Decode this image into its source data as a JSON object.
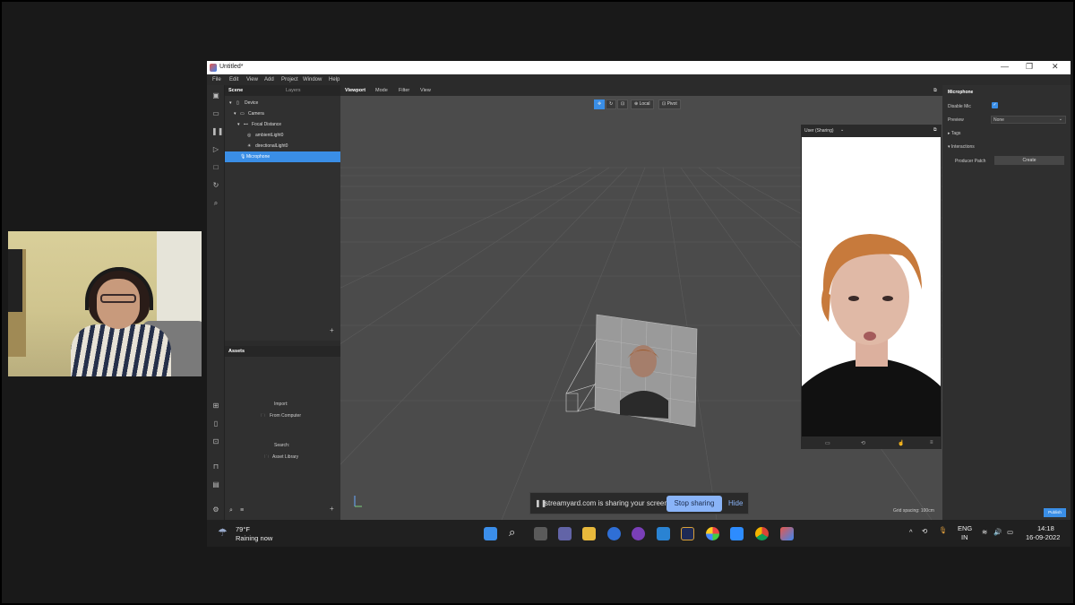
{
  "window": {
    "title": "Untitled*",
    "min": "—",
    "max": "❐",
    "close": "✕"
  },
  "menu": [
    "File",
    "Edit",
    "View",
    "Add",
    "Project",
    "Window",
    "Help"
  ],
  "scene": {
    "tab_scene": "Scene",
    "tab_layers": "Layers",
    "items": [
      {
        "label": "Device"
      },
      {
        "label": "Camera"
      },
      {
        "label": "Focal Distance"
      },
      {
        "label": "ambientLight0"
      },
      {
        "label": "directionalLight0"
      },
      {
        "label": "Microphone"
      }
    ],
    "add": "+"
  },
  "assets": {
    "title": "Assets",
    "import_label": "Import:",
    "from_computer": "From Computer",
    "search_label": "Search:",
    "asset_library": "Asset Library",
    "add": "+"
  },
  "viewport": {
    "tabs": [
      "Viewport",
      "Mode",
      "Filter",
      "View"
    ],
    "local": "Local",
    "pivot": "Pivot",
    "grid_spacing": "Grid spacing: 100cm"
  },
  "simulator": {
    "device": "User (Sharing)"
  },
  "inspector": {
    "title": "Microphone",
    "disable_mic": "Disable Mic",
    "disable_mic_checked": true,
    "preview_label": "Preview",
    "preview_value": "None",
    "tags": "Tags",
    "interactions": "Interactions",
    "producer_patch": "Producer Patch",
    "create": "Create",
    "publish": "Publish"
  },
  "share": {
    "message": "streamyard.com is sharing your screen.",
    "stop": "Stop sharing",
    "hide": "Hide"
  },
  "taskbar": {
    "weather_temp": "79°F",
    "weather_desc": "Raining now",
    "lang1": "ENG",
    "lang2": "IN",
    "time": "14:18",
    "date": "16-09-2022"
  },
  "colors": {
    "selection": "#3a8ee6",
    "checkbox": "#3a8ee6",
    "stop_button": "#8ab4f8"
  }
}
